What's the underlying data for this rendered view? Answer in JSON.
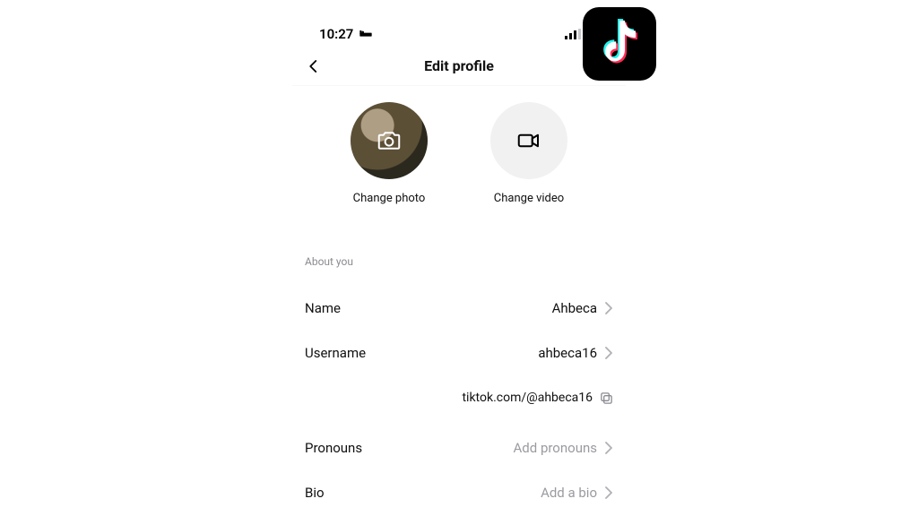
{
  "status": {
    "time": "10:27"
  },
  "nav": {
    "title": "Edit profile"
  },
  "media": {
    "change_photo": "Change photo",
    "change_video": "Change video"
  },
  "section": {
    "about_you": "About you"
  },
  "rows": {
    "name_label": "Name",
    "name_value": "Ahbeca",
    "username_label": "Username",
    "username_value": "ahbeca16",
    "profile_link": "tiktok.com/@ahbeca16",
    "pronouns_label": "Pronouns",
    "pronouns_placeholder": "Add pronouns",
    "bio_label": "Bio",
    "bio_placeholder": "Add a bio"
  }
}
